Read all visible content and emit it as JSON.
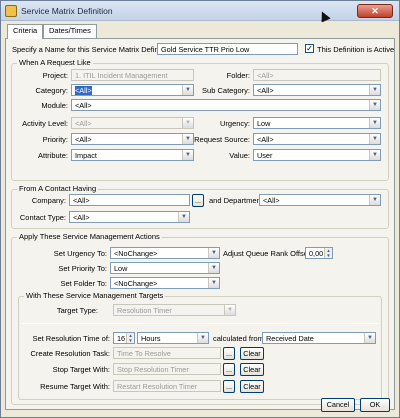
{
  "window": {
    "title": "Service Matrix Definition",
    "close_glyph": "✕"
  },
  "tabs": [
    {
      "label": "Criteria"
    },
    {
      "label": "Dates/Times"
    }
  ],
  "name": {
    "label": "Specify a Name for this Service Matrix Definition:",
    "value": "Gold Service TTR Prio Low",
    "active_label": "This Definition is Active",
    "active_checked": true
  },
  "request": {
    "group_title": "When A Request Like",
    "project_label": "Project:",
    "project_value": "1. ITIL Incident Management",
    "folder_label": "Folder:",
    "folder_value": "<All>",
    "category_label": "Category:",
    "category_value": "<All>",
    "subcategory_label": "Sub Category:",
    "subcategory_value": "<All>",
    "module_label": "Module:",
    "module_value": "<All>",
    "activity_label": "Activity Level:",
    "activity_value": "<All>",
    "urgency_label": "Urgency:",
    "urgency_value": "Low",
    "priority_label": "Priority:",
    "priority_value": "<All>",
    "source_label": "Request Source:",
    "source_value": "<All>",
    "attribute_label": "Attribute:",
    "attribute_value": "Impact",
    "value_label": "Value:",
    "value_value": "User"
  },
  "contact": {
    "group_title": "From A Contact Having",
    "company_label": "Company:",
    "company_value": "<All>",
    "browse": "...",
    "department_label": "and Department:",
    "department_value": "<All>",
    "type_label": "Contact Type:",
    "type_value": "<All>"
  },
  "actions": {
    "group_title": "Apply These Service Management Actions",
    "urgency_label": "Set Urgency To:",
    "urgency_value": "<NoChange>",
    "queue_label": "Adjust Queue Rank Offset:",
    "queue_value": "0,00",
    "priority_label": "Set Priority To:",
    "priority_value": "Low",
    "folder_label": "Set Folder To:",
    "folder_value": "<NoChange>"
  },
  "targets": {
    "group_title": "With These Service Management Targets",
    "type_label": "Target Type:",
    "type_value": "Resolution Timer",
    "time_label": "Set Resolution Time of:",
    "time_value": "16",
    "unit_value": "Hours",
    "calc_label": "calculated from",
    "calc_value": "Received Date",
    "create_label": "Create Resolution Task:",
    "create_value": "Time To Resolve",
    "stop_label": "Stop Target With:",
    "stop_value": "Stop Resolution Timer",
    "resume_label": "Resume Target With:",
    "resume_value": "Restart Resolution Timer",
    "browse": "...",
    "clear": "Clear"
  },
  "footer": {
    "cancel": "Cancel",
    "ok": "OK"
  }
}
